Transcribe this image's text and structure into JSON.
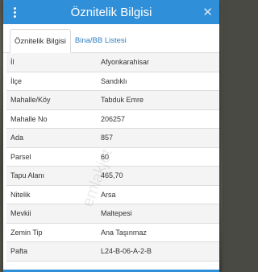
{
  "header": {
    "title": "Öznitelik Bilgisi",
    "close_label": "✕"
  },
  "tabs": [
    {
      "label": "Öznitelik Bilgisi",
      "active": true
    },
    {
      "label": "Bina/BB Listesi",
      "active": false
    }
  ],
  "rows": [
    {
      "key": "İl",
      "value": "Afyonkarahisar"
    },
    {
      "key": "İlçe",
      "value": "Sandıklı"
    },
    {
      "key": "Mahalle/Köy",
      "value": "Tabduk Emre"
    },
    {
      "key": "Mahalle No",
      "value": "206257"
    },
    {
      "key": "Ada",
      "value": "857"
    },
    {
      "key": "Parsel",
      "value": "60"
    },
    {
      "key": "Tapu Alanı",
      "value": "465,70"
    },
    {
      "key": "Nitelik",
      "value": "Arsa"
    },
    {
      "key": "Mevkii",
      "value": "Maltepesi"
    },
    {
      "key": "Zemin Tip",
      "value": "Ana Taşınmaz"
    },
    {
      "key": "Pafta",
      "value": "L24-B-06-A-2-B"
    }
  ],
  "watermark": "emlakjet",
  "colors": {
    "header": "#2f8fd8",
    "tab_link": "#2f7fc2"
  }
}
